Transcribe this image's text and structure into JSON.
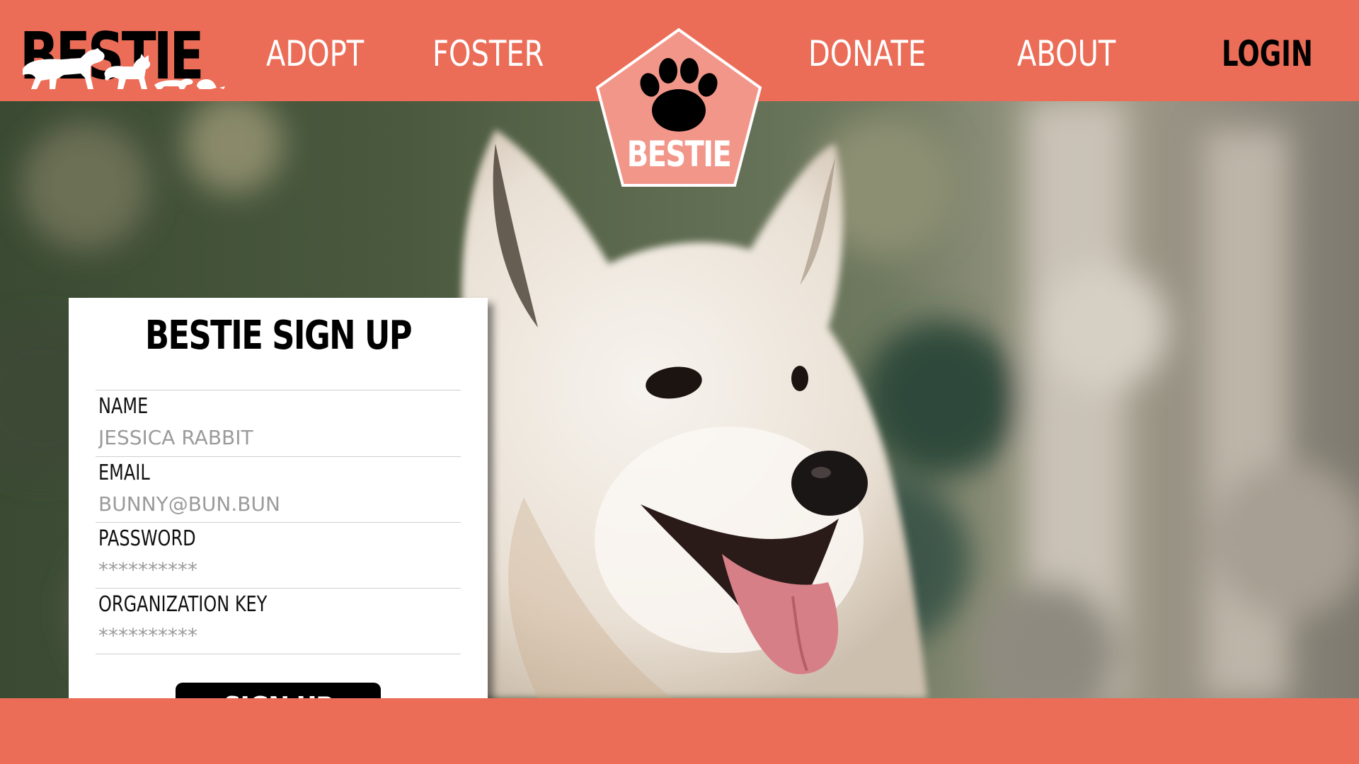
{
  "brand": {
    "logo_text": "BESTIE",
    "badge_text": "BESTIE"
  },
  "nav": {
    "adopt": "ADOPT",
    "foster": "FOSTER",
    "donate": "DONATE",
    "about": "ABOUT",
    "login": "LOGIN"
  },
  "signup": {
    "title": "BESTIE SIGN UP",
    "fields": [
      {
        "label": "NAME",
        "placeholder": "JESSICA RABBIT"
      },
      {
        "label": "EMAIL",
        "placeholder": "BUNNY@BUN.BUN"
      },
      {
        "label": "PASSWORD",
        "placeholder": "**********"
      },
      {
        "label": "ORGANIZATION KEY",
        "placeholder": "**********"
      }
    ],
    "button_label": "SIGN UP"
  },
  "colors": {
    "brand_coral": "#EB6D58",
    "badge_pink": "#F2968A",
    "button_black": "#000000"
  },
  "icons": [
    "paw-icon",
    "dog-silhouette-icon",
    "cat-silhouette-icon",
    "ferret-silhouette-icon",
    "hamster-silhouette-icon"
  ]
}
